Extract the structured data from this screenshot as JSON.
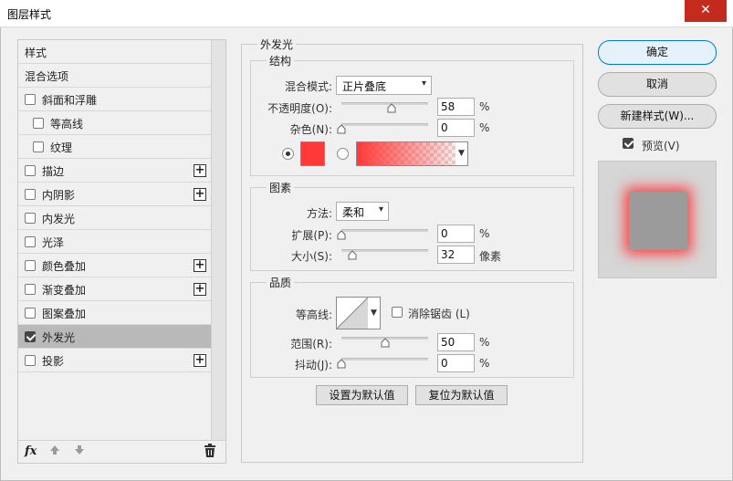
{
  "window": {
    "title": "图层样式",
    "close_glyph": "✕"
  },
  "colors": {
    "glow": "#ff3838",
    "selected_row": "#b9b9b9",
    "accent": "#0078d7",
    "close_bg": "#c42b1c"
  },
  "style_list": {
    "items": [
      {
        "label": "样式",
        "checkbox": false,
        "checked": false,
        "plus": false,
        "indent": false,
        "selected": false
      },
      {
        "label": "混合选项",
        "checkbox": false,
        "checked": false,
        "plus": false,
        "indent": false,
        "selected": false
      },
      {
        "label": "斜面和浮雕",
        "checkbox": true,
        "checked": false,
        "plus": false,
        "indent": false,
        "selected": false
      },
      {
        "label": "等高线",
        "checkbox": true,
        "checked": false,
        "plus": false,
        "indent": true,
        "selected": false
      },
      {
        "label": "纹理",
        "checkbox": true,
        "checked": false,
        "plus": false,
        "indent": true,
        "selected": false
      },
      {
        "label": "描边",
        "checkbox": true,
        "checked": false,
        "plus": true,
        "indent": false,
        "selected": false
      },
      {
        "label": "内阴影",
        "checkbox": true,
        "checked": false,
        "plus": true,
        "indent": false,
        "selected": false
      },
      {
        "label": "内发光",
        "checkbox": true,
        "checked": false,
        "plus": false,
        "indent": false,
        "selected": false
      },
      {
        "label": "光泽",
        "checkbox": true,
        "checked": false,
        "plus": false,
        "indent": false,
        "selected": false
      },
      {
        "label": "颜色叠加",
        "checkbox": true,
        "checked": false,
        "plus": true,
        "indent": false,
        "selected": false
      },
      {
        "label": "渐变叠加",
        "checkbox": true,
        "checked": false,
        "plus": true,
        "indent": false,
        "selected": false
      },
      {
        "label": "图案叠加",
        "checkbox": true,
        "checked": false,
        "plus": false,
        "indent": false,
        "selected": false
      },
      {
        "label": "外发光",
        "checkbox": true,
        "checked": true,
        "plus": false,
        "indent": false,
        "selected": true
      },
      {
        "label": "投影",
        "checkbox": true,
        "checked": false,
        "plus": true,
        "indent": false,
        "selected": false
      }
    ],
    "footer": {
      "fx_label": "fx",
      "up_icon": "arrow-up-icon",
      "down_icon": "arrow-down-icon",
      "trash_icon": "trash-icon"
    }
  },
  "outer_glow": {
    "section_title": "外发光",
    "structure": {
      "title": "结构",
      "blend_mode_label": "混合模式:",
      "blend_mode_value": "正片叠底",
      "opacity_label": "不透明度(O):",
      "opacity_value": "58",
      "opacity_unit": "%",
      "opacity_fraction": 0.58,
      "noise_label": "杂色(N):",
      "noise_value": "0",
      "noise_unit": "%",
      "noise_fraction": 0.0,
      "color_mode": "solid"
    },
    "elements": {
      "title": "图素",
      "technique_label": "方法:",
      "technique_value": "柔和",
      "spread_label": "扩展(P):",
      "spread_value": "0",
      "spread_unit": "%",
      "spread_fraction": 0.0,
      "size_label": "大小(S):",
      "size_value": "32",
      "size_unit": "像素",
      "size_fraction": 0.13
    },
    "quality": {
      "title": "品质",
      "contour_label": "等高线:",
      "antialias_label": "消除锯齿 (L)",
      "antialias_checked": false,
      "range_label": "范围(R):",
      "range_value": "50",
      "range_unit": "%",
      "range_fraction": 0.5,
      "jitter_label": "抖动(J):",
      "jitter_value": "0",
      "jitter_unit": "%",
      "jitter_fraction": 0.0
    },
    "make_default_label": "设置为默认值",
    "reset_default_label": "复位为默认值"
  },
  "actions": {
    "ok_label": "确定",
    "cancel_label": "取消",
    "new_style_label": "新建样式(W)...",
    "preview_label": "预览(V)",
    "preview_checked": true
  }
}
